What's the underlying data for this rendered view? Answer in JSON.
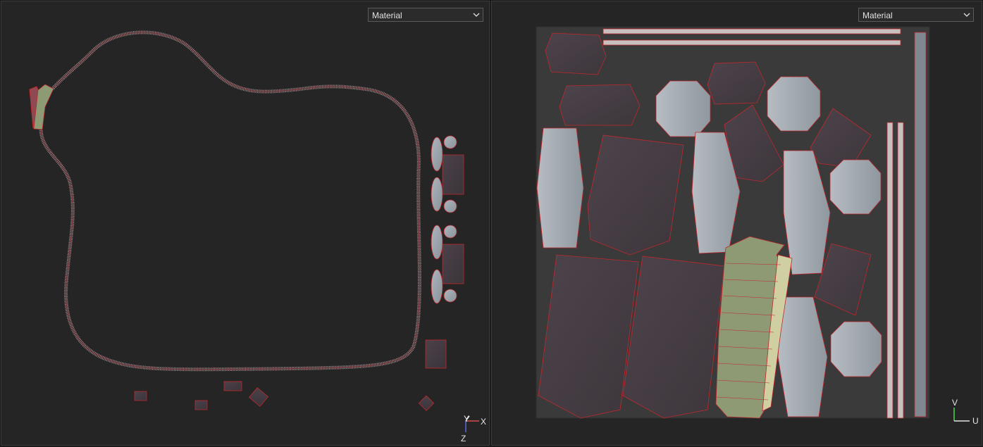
{
  "left_viewport": {
    "shading_select": {
      "value": "Material",
      "icon": "chevron-down-icon"
    },
    "axis_gizmo": {
      "y_label": "Y",
      "x_label": "X",
      "z_label": "Z",
      "colors": {
        "x": "#d84b4b",
        "y": "#e6e6e6",
        "z": "#5b6bd8"
      }
    }
  },
  "right_viewport": {
    "shading_select": {
      "value": "Material",
      "icon": "chevron-down-icon"
    },
    "uv_gizmo": {
      "v_label": "V",
      "u_label": "U",
      "colors": {
        "u": "#e6e6e6",
        "v": "#4bd84b"
      }
    }
  },
  "colors": {
    "background": "#252525",
    "uv_tile": "#3a3a3a",
    "wire": "#c0272d",
    "dark_face": "#4a4148",
    "light_face": "#9fa6ad",
    "selected_face": "#8e9a74"
  }
}
